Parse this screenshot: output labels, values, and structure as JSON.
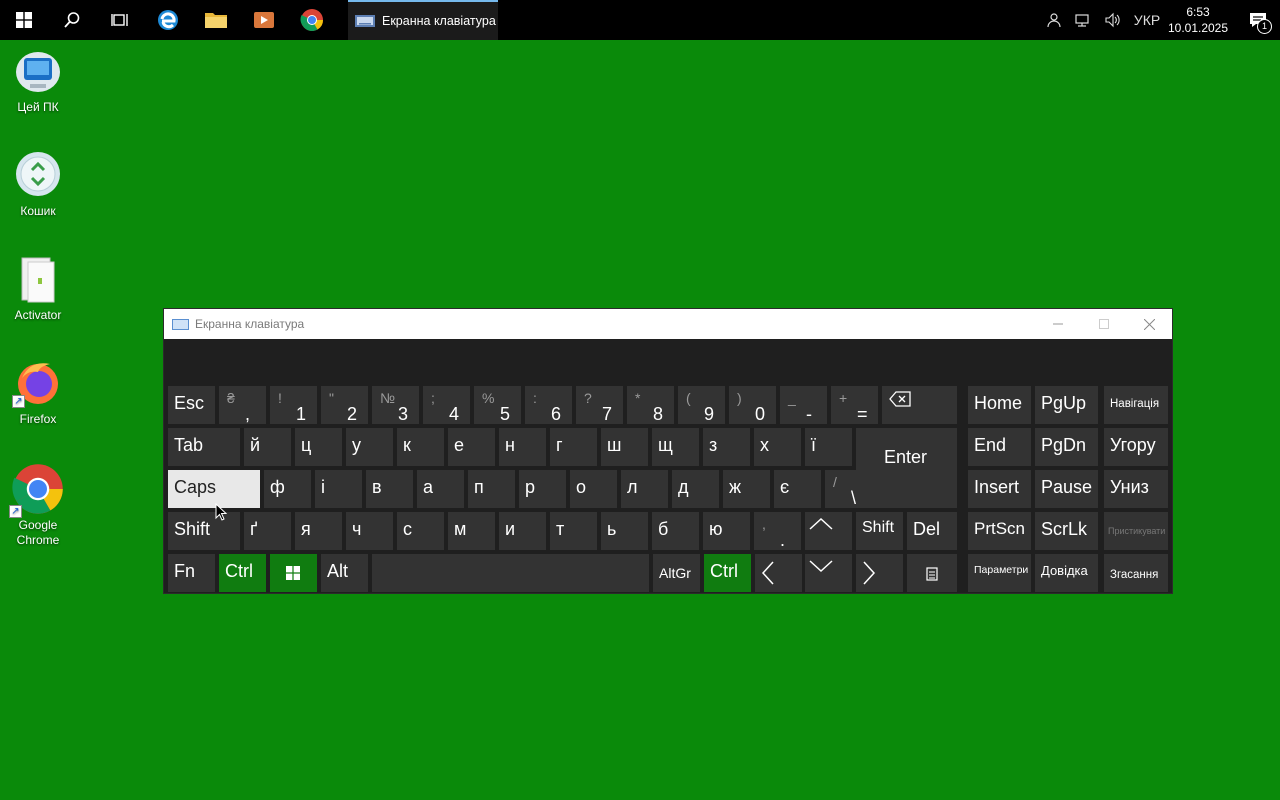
{
  "taskbar": {
    "active_app_title": "Екранна клавіатура",
    "language": "УКР",
    "time": "6:53",
    "date": "10.01.2025",
    "notification_count": "1"
  },
  "desktop": {
    "icons": [
      {
        "label": "Цей ПК"
      },
      {
        "label": "Кошик"
      },
      {
        "label": "Activator"
      },
      {
        "label": "Firefox"
      },
      {
        "label": "Google Chrome"
      }
    ]
  },
  "osk": {
    "title": "Екранна клавіатура",
    "keys": {
      "esc": "Esc",
      "tab": "Tab",
      "caps": "Caps",
      "shift": "Shift",
      "fn": "Fn",
      "ctrl": "Ctrl",
      "alt": "Alt",
      "altgr": "AltGr",
      "enter": "Enter",
      "rshift": "Shift",
      "del": "Del",
      "home": "Home",
      "pgup": "PgUp",
      "nav": "Навігація",
      "end": "End",
      "pgdn": "PgDn",
      "up_alt": "Угору",
      "insert": "Insert",
      "pause": "Pause",
      "down_alt": "Униз",
      "prtscn": "PrtScn",
      "scrlk": "ScrLk",
      "dock": "Пристикувати",
      "options": "Параметри",
      "help": "Довідка",
      "fade": "Згасання"
    },
    "number_row": [
      {
        "shift": "₴",
        "base": ","
      },
      {
        "shift": "!",
        "base": "1"
      },
      {
        "shift": "\"",
        "base": "2"
      },
      {
        "shift": "№",
        "base": "3"
      },
      {
        "shift": ";",
        "base": "4"
      },
      {
        "shift": "%",
        "base": "5"
      },
      {
        "shift": ":",
        "base": "6"
      },
      {
        "shift": "?",
        "base": "7"
      },
      {
        "shift": "*",
        "base": "8"
      },
      {
        "shift": "(",
        "base": "9"
      },
      {
        "shift": ")",
        "base": "0"
      },
      {
        "shift": "_",
        "base": "-"
      },
      {
        "shift": "+",
        "base": "="
      }
    ],
    "row_q": [
      "й",
      "ц",
      "у",
      "к",
      "е",
      "н",
      "г",
      "ш",
      "щ",
      "з",
      "х",
      "ї"
    ],
    "row_a": [
      "ф",
      "і",
      "в",
      "а",
      "п",
      "р",
      "о",
      "л",
      "д",
      "ж",
      "є"
    ],
    "backslash": {
      "shift": "/",
      "base": "\\"
    },
    "row_z": [
      "ґ",
      "я",
      "ч",
      "с",
      "м",
      "и",
      "т",
      "ь",
      "б",
      "ю"
    ],
    "period": {
      "shift": ",",
      "base": "."
    }
  }
}
